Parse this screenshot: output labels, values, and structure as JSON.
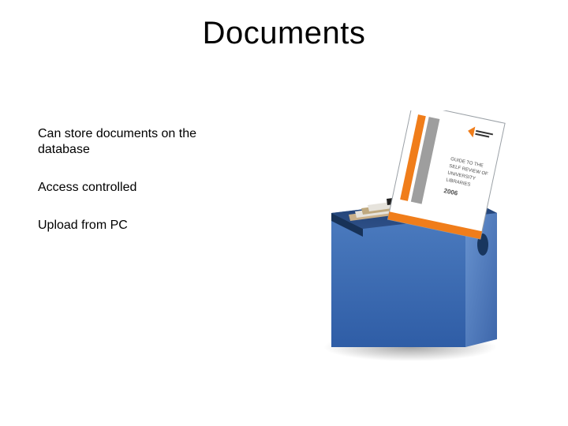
{
  "title": "Documents",
  "bullets": {
    "b1": "Can store documents on the database",
    "b2": "Access controlled",
    "b3": "Upload from PC"
  },
  "illustration": {
    "doc_card": {
      "lines": [
        "GUIDE TO THE",
        "SELF REVIEW OF",
        "UNIVERSITY",
        "LIBRARIES"
      ],
      "year": "2006"
    }
  }
}
